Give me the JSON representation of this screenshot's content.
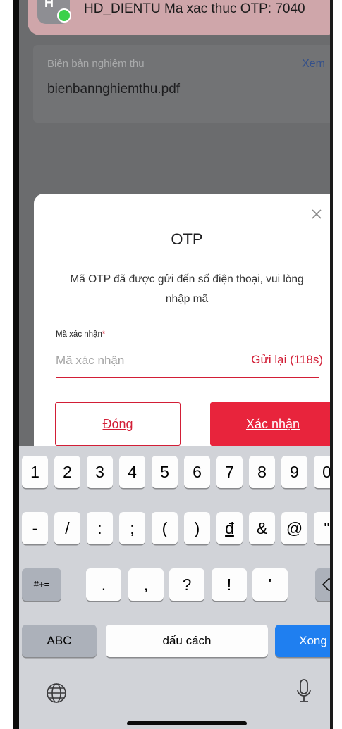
{
  "notification": {
    "app_initial": "H",
    "text": "HD_DIENTU Ma xac thuc OTP: 7040"
  },
  "document": {
    "label": "Biên bản nghiệm thu",
    "filename": "bienbannghiemthu.pdf",
    "view_link": "Xem"
  },
  "modal": {
    "title": "OTP",
    "description": "Mã OTP đã được gửi đến số điện thoại, vui lòng nhập mã",
    "field_label": "Mã xác nhận",
    "required_mark": "*",
    "field_value": "",
    "field_placeholder": "Mã xác nhận",
    "resend_label": "Gửi lại (118s)",
    "close_button": "Đóng",
    "confirm_button": "Xác nhận",
    "close_icon": "close-icon"
  },
  "keyboard": {
    "row1": [
      "1",
      "2",
      "3",
      "4",
      "5",
      "6",
      "7",
      "8",
      "9",
      "0"
    ],
    "row2": [
      "-",
      "/",
      ":",
      ";",
      "(",
      ")",
      "đ",
      "&",
      "@",
      "\""
    ],
    "row3_shift": "#+=",
    "row3": [
      ".",
      ",",
      "?",
      "!",
      "'"
    ],
    "abc_label": "ABC",
    "space_label": "dấu cách",
    "done_label": "Xong",
    "icons": [
      "backspace-icon",
      "globe-icon",
      "microphone-icon"
    ]
  },
  "colors": {
    "accent_red": "#e8243c",
    "done_blue": "#1f7ff0"
  }
}
